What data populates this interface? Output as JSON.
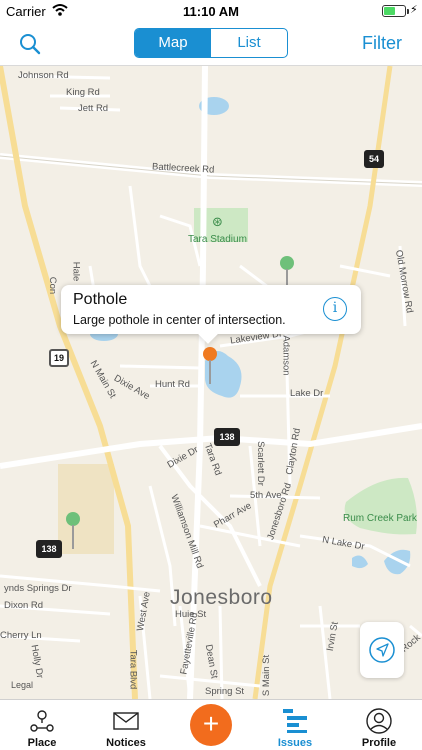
{
  "status_bar": {
    "carrier": "Carrier",
    "time": "11:10 AM",
    "battery_level": 0.55,
    "charge_glyph": "⚡"
  },
  "nav": {
    "search_icon": "search-icon",
    "segments": [
      {
        "label": "Map",
        "selected": true
      },
      {
        "label": "List",
        "selected": false
      }
    ],
    "filter_label": "Filter",
    "accent_color": "#1a8fd2"
  },
  "map": {
    "road_labels": {
      "johnson": "Johnson Rd",
      "king": "King Rd",
      "jett": "Jett Rd",
      "battlecreek": "Battlecreek Rd",
      "old_morrow": "Old Morrow Rd",
      "hal": "Hale",
      "con": "Con",
      "lakeview": "Lakeview Dr",
      "adamson": "Adamson",
      "n_main": "N Main St",
      "dixie_ave": "Dixie Ave",
      "hunt": "Hunt Rd",
      "lake": "Lake Dr",
      "dixie_dr": "Dixie Dr",
      "tara_rd": "Tara Rd",
      "scarlett": "Scarlett Dr",
      "clayton": "Clayton Rd",
      "fifth_ave": "5th Ave",
      "jonesboro_rd": "Jonesboro Rd",
      "pharr": "Pharr Ave",
      "williamson": "Williamson Mill Rd",
      "n_lake": "N Lake Dr",
      "lynds": "ynds Springs Dr",
      "dixon": "Dixon Rd",
      "west_ave": "West Ave",
      "huie": "Huie St",
      "irvin": "Irvin St",
      "cherry": "Cherry Ln",
      "holly": "Holly Dr",
      "fayetteville": "Fayetteville Rd",
      "dean": "Dean St",
      "tara_blvd": "Tara Blvd",
      "s_main": "S Main St",
      "spring": "Spring St",
      "rock": "Rock"
    },
    "place_labels": {
      "stadium": "Tara Stadium",
      "park": "Rum Creek Park",
      "city": "Jonesboro"
    },
    "shields": {
      "r54": "54",
      "r19": "19",
      "r138a": "138",
      "r138b": "138"
    },
    "legal": "Legal",
    "pin_colors": {
      "selected": "#f07a20",
      "other": "#6ec07a"
    },
    "callout": {
      "title": "Pothole",
      "subtitle": "Large pothole in center of intersection.",
      "info_glyph": "i"
    }
  },
  "tabs": [
    {
      "label": "Place",
      "icon": "place-icon",
      "active": false
    },
    {
      "label": "Notices",
      "icon": "mail-icon",
      "active": false
    },
    {
      "label": "",
      "icon": "add-icon",
      "glyph": "+",
      "active": false
    },
    {
      "label": "Issues",
      "icon": "issues-list-icon",
      "active": true
    },
    {
      "label": "Profile",
      "icon": "profile-icon",
      "active": false
    }
  ]
}
